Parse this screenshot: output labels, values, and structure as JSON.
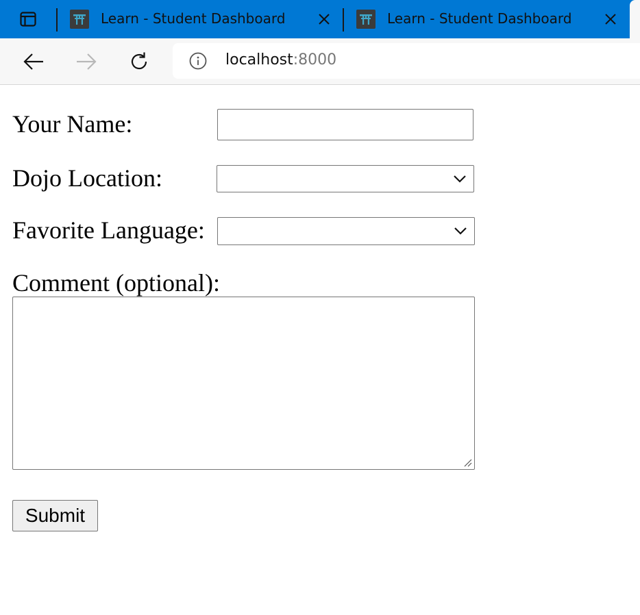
{
  "browser": {
    "tabs": [
      {
        "title": "Learn - Student Dashboard",
        "favicon": "torii-gate-icon"
      },
      {
        "title": "Learn - Student Dashboard",
        "favicon": "torii-gate-icon"
      }
    ],
    "url": {
      "host": "localhost",
      "port": ":8000"
    },
    "colors": {
      "titlebar": "#0078d4",
      "favicon_bg": "#3b3b3b",
      "favicon_fg": "#3fa7c9"
    }
  },
  "form": {
    "name": {
      "label": "Your Name:",
      "value": ""
    },
    "location": {
      "label": "Dojo Location:",
      "selected": ""
    },
    "language": {
      "label": "Favorite Language:",
      "selected": ""
    },
    "comment": {
      "label": "Comment (optional):",
      "value": ""
    },
    "submit_label": "Submit"
  }
}
